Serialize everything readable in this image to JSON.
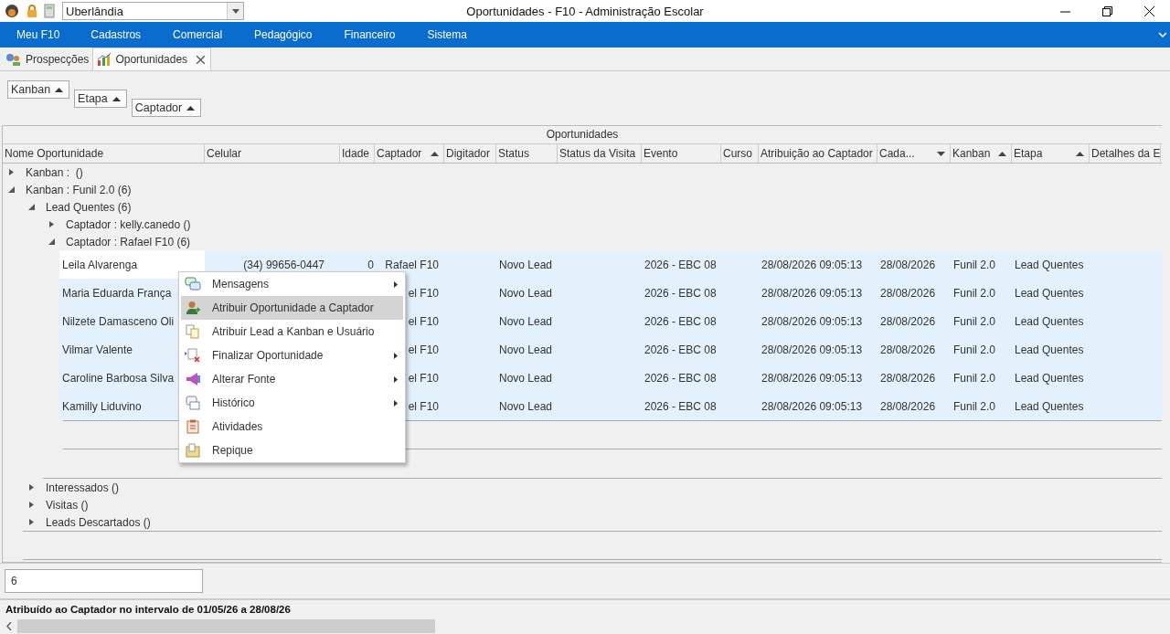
{
  "titlebar": {
    "city": "Uberlândia",
    "title": "Oportunidades - F10 - Administração Escolar"
  },
  "menu": [
    "Meu F10",
    "Cadastros",
    "Comercial",
    "Pedagógico",
    "Financeiro",
    "Sistema"
  ],
  "tabs": [
    {
      "label": "Prospecções",
      "selected": false
    },
    {
      "label": "Oportunidades",
      "selected": true
    }
  ],
  "group_by": [
    {
      "label": "Kanban",
      "descending": false
    },
    {
      "label": "Etapa",
      "descending": false
    },
    {
      "label": "Captador",
      "descending": false
    }
  ],
  "grid": {
    "band": "Oportunidades",
    "columns": [
      {
        "label": "Nome Oportunidade",
        "sorted": false
      },
      {
        "label": "Celular",
        "sorted": false
      },
      {
        "label": "Idade",
        "sorted": false
      },
      {
        "label": "Captador",
        "sorted": true,
        "descending": false
      },
      {
        "label": "Digitador",
        "sorted": false
      },
      {
        "label": "Status",
        "sorted": false
      },
      {
        "label": "Status da Visita",
        "sorted": false
      },
      {
        "label": "Evento",
        "sorted": false
      },
      {
        "label": "Curso",
        "sorted": false
      },
      {
        "label": "Atribuição ao Captador",
        "sorted": false
      },
      {
        "label": "Cada...",
        "sorted": true,
        "descending": true
      },
      {
        "label": "Kanban",
        "sorted": true,
        "descending": false
      },
      {
        "label": "Etapa",
        "sorted": true,
        "descending": false
      },
      {
        "label": "Detalhes da E",
        "sorted": false
      }
    ],
    "tree": [
      {
        "label": "Kanban :  ()",
        "expanded": false
      },
      {
        "label": "Kanban : Funil 2.0 (6)",
        "expanded": true,
        "children": [
          {
            "label": "Lead Quentes (6)",
            "expanded": true,
            "children": [
              {
                "label": "Captador : kelly.canedo ()",
                "expanded": false
              },
              {
                "label": "Captador : Rafael F10 (6)",
                "expanded": true,
                "rows": [
                  {
                    "selected": true,
                    "focused": true,
                    "nome": "Leila Alvarenga",
                    "celular": "(34) 99656-0447",
                    "idade": "0",
                    "captador": "Rafael F10",
                    "status": "Novo Lead",
                    "evento": "2026 - EBC 08",
                    "atribuicao": "28/08/2026 09:05:13",
                    "cada": "28/08/2026",
                    "kanban": "Funil 2.0",
                    "etapa": "Lead Quentes"
                  },
                  {
                    "selected": true,
                    "focused": false,
                    "nome": "Maria Eduarda França",
                    "captador": "el F10",
                    "status": "Novo Lead",
                    "evento": "2026 - EBC 08",
                    "atribuicao": "28/08/2026 09:05:13",
                    "cada": "28/08/2026",
                    "kanban": "Funil 2.0",
                    "etapa": "Lead Quentes"
                  },
                  {
                    "selected": true,
                    "focused": false,
                    "nome": "Nilzete Damasceno Oli",
                    "captador": "el F10",
                    "status": "Novo Lead",
                    "evento": "2026 - EBC 08",
                    "atribuicao": "28/08/2026 09:05:13",
                    "cada": "28/08/2026",
                    "kanban": "Funil 2.0",
                    "etapa": "Lead Quentes"
                  },
                  {
                    "selected": true,
                    "focused": false,
                    "nome": "Vilmar Valente",
                    "captador": "el F10",
                    "status": "Novo Lead",
                    "evento": "2026 - EBC 08",
                    "atribuicao": "28/08/2026 09:05:13",
                    "cada": "28/08/2026",
                    "kanban": "Funil 2.0",
                    "etapa": "Lead Quentes"
                  },
                  {
                    "selected": true,
                    "focused": false,
                    "nome": "Caroline Barbosa Silva",
                    "captador": "el F10",
                    "status": "Novo Lead",
                    "evento": "2026 - EBC 08",
                    "atribuicao": "28/08/2026 09:05:13",
                    "cada": "28/08/2026",
                    "kanban": "Funil 2.0",
                    "etapa": "Lead Quentes"
                  },
                  {
                    "selected": true,
                    "focused": false,
                    "nome": "Kamilly Liduvino",
                    "captador": "el F10",
                    "status": "Novo Lead",
                    "evento": "2026 - EBC 08",
                    "atribuicao": "28/08/2026 09:05:13",
                    "cada": "28/08/2026",
                    "kanban": "Funil 2.0",
                    "etapa": "Lead Quentes"
                  }
                ]
              }
            ]
          },
          {
            "label": "Interessados ()",
            "expanded": false
          },
          {
            "label": "Visitas ()",
            "expanded": false
          },
          {
            "label": "Leads Descartados ()",
            "expanded": false
          }
        ]
      }
    ]
  },
  "context_menu": [
    {
      "label": "Mensagens",
      "submenu": true,
      "selected": false
    },
    {
      "label": "Atribuir Oportunidade a Captador",
      "submenu": false,
      "selected": true
    },
    {
      "label": "Atribuir Lead a Kanban e Usuário",
      "submenu": false,
      "selected": false
    },
    {
      "label": "Finalizar Oportunidade",
      "submenu": true,
      "selected": false
    },
    {
      "label": "Alterar Fonte",
      "submenu": true,
      "selected": false
    },
    {
      "label": "Histórico",
      "submenu": true,
      "selected": false
    },
    {
      "label": "Atividades",
      "submenu": false,
      "selected": false
    },
    {
      "label": "Repique",
      "submenu": false,
      "selected": false
    }
  ],
  "footer": {
    "search_value": "6",
    "status": "Atribuído ao Captador no intervalo de 01/05/26 a 28/08/26"
  }
}
